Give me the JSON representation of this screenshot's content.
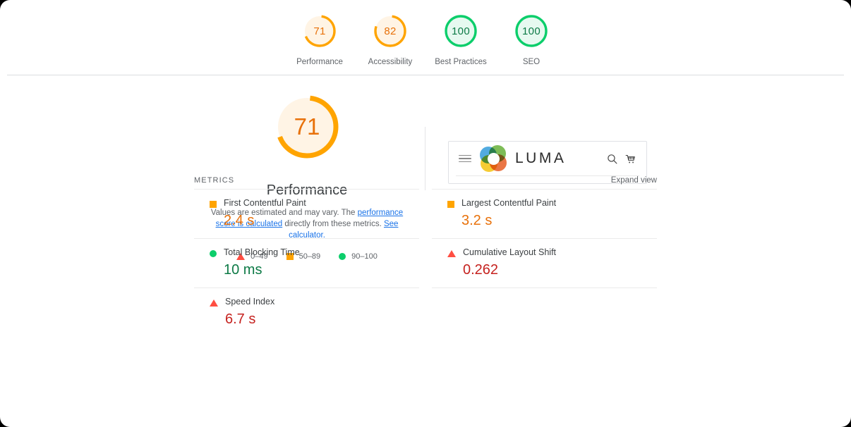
{
  "theme": {
    "orange": "#ffa400",
    "orange_text": "#e8710a",
    "green": "#0cce6b",
    "red": "#ff4e42",
    "red_text": "#c5221f",
    "orange_bg": "#fff4e5",
    "green_bg": "#e6f9f0",
    "link": "#1a73e8",
    "text": "#3c4043",
    "muted": "#5f6368"
  },
  "category_scores": [
    {
      "label": "Performance",
      "value": 71,
      "display": "71",
      "rating": "average"
    },
    {
      "label": "Accessibility",
      "value": 82,
      "display": "82",
      "rating": "average"
    },
    {
      "label": "Best Practices",
      "value": 100,
      "display": "100",
      "rating": "pass"
    },
    {
      "label": "SEO",
      "value": 100,
      "display": "100",
      "rating": "pass"
    }
  ],
  "performance": {
    "gauge_value": 71,
    "gauge_display": "71",
    "title": "Performance",
    "description": {
      "part1": "Values are estimated and may vary. The ",
      "link1": "performance score is calculated",
      "part2": " directly from these metrics. ",
      "link2": "See calculator."
    },
    "legend": [
      {
        "shape": "triangle-icon",
        "range": "0–49",
        "color": "#ff4e42"
      },
      {
        "shape": "square-icon",
        "range": "50–89",
        "color": "#ffa400"
      },
      {
        "shape": "circle-icon",
        "range": "90–100",
        "color": "#0cce6b"
      }
    ]
  },
  "thumbnail": {
    "brand": "LUMA",
    "menu_icon": "hamburger-icon",
    "logo_icon": "luma-logo-icon",
    "search_icon": "search-icon",
    "cart_icon": "shopping-cart-icon"
  },
  "metrics_section": {
    "title": "METRICS",
    "expand_label": "Expand view",
    "left_column": [
      {
        "name": "First Contentful Paint",
        "value": "2.4 s",
        "rating": "average",
        "shape": "square-icon"
      },
      {
        "name": "Total Blocking Time",
        "value": "10 ms",
        "rating": "pass",
        "shape": "circle-icon"
      },
      {
        "name": "Speed Index",
        "value": "6.7 s",
        "rating": "fail",
        "shape": "triangle-icon"
      }
    ],
    "right_column": [
      {
        "name": "Largest Contentful Paint",
        "value": "3.2 s",
        "rating": "average",
        "shape": "square-icon"
      },
      {
        "name": "Cumulative Layout Shift",
        "value": "0.262",
        "rating": "fail",
        "shape": "triangle-icon"
      }
    ]
  }
}
